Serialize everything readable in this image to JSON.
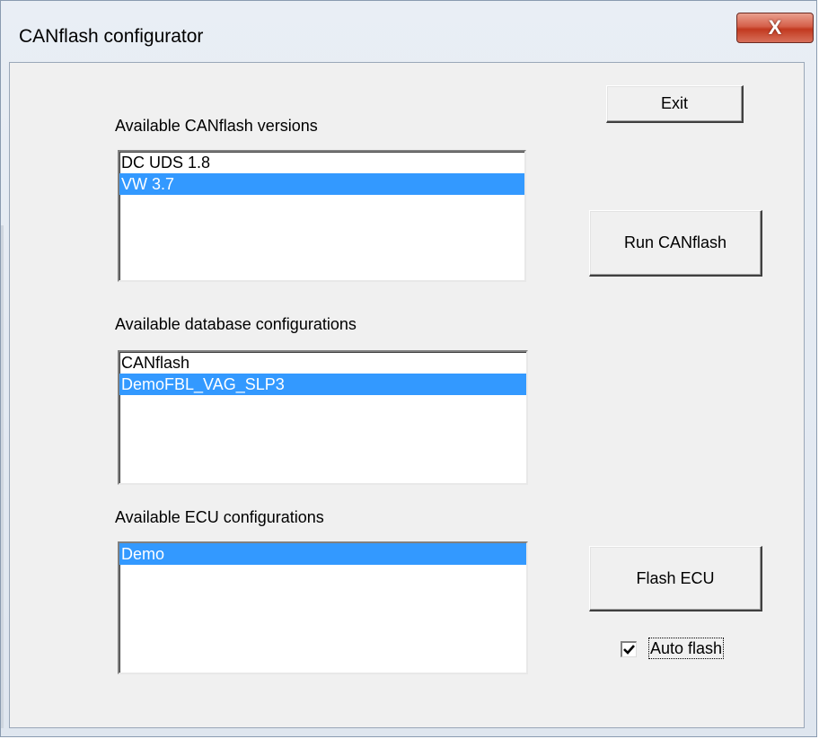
{
  "window": {
    "title": "CANflash configurator",
    "close_label": "X"
  },
  "versions": {
    "label": "Available CANflash versions",
    "items": [
      {
        "label": "DC UDS 1.8",
        "selected": false
      },
      {
        "label": "VW 3.7",
        "selected": true
      }
    ]
  },
  "databases": {
    "label": "Available database configurations",
    "items": [
      {
        "label": "CANflash",
        "selected": false
      },
      {
        "label": "DemoFBL_VAG_SLP3",
        "selected": true
      }
    ]
  },
  "ecus": {
    "label": "Available ECU configurations",
    "items": [
      {
        "label": "Demo",
        "selected": true
      }
    ]
  },
  "buttons": {
    "exit": "Exit",
    "run": "Run CANflash",
    "flash": "Flash ECU"
  },
  "auto_flash": {
    "label": "Auto flash",
    "checked": true
  },
  "colors": {
    "selection": "#3399ff",
    "dialog_face": "#f0f0f0",
    "close_button": "#c2391f"
  }
}
